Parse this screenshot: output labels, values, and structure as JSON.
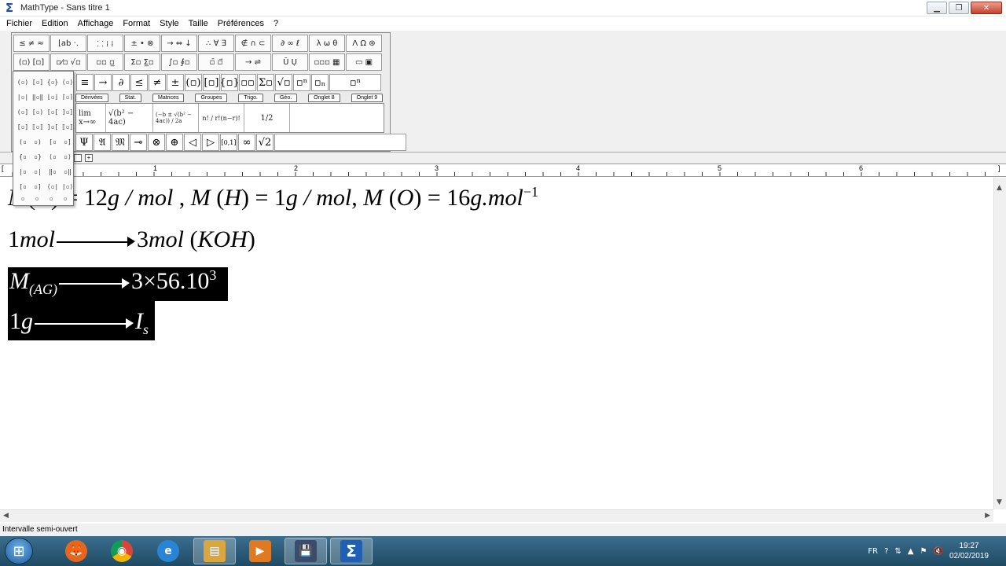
{
  "window": {
    "title": "MathType - Sans titre 1",
    "app_icon": "Σ",
    "minimize": "▁",
    "maximize": "❐",
    "close": "✕"
  },
  "menu": [
    "Fichier",
    "Edition",
    "Affichage",
    "Format",
    "Style",
    "Taille",
    "Préférences",
    "?"
  ],
  "palette": {
    "row1": [
      "≤ ≠ ≈",
      "⌊ab ·.",
      "⸬ ⁞ ⁞",
      "± • ⊗",
      "→ ⇔ ↓",
      "∴ ∀ ∃",
      "∉ ∩ ⊂",
      "∂ ∞ ℓ",
      "λ ω θ",
      "Λ Ω ⊛"
    ],
    "row2": [
      "(▫) [▫]",
      "▫⁄▫ √▫",
      "▫▫ ▫̲",
      "Σ▫ Σ̲▫",
      "∫▫ ∮▫",
      "▫̄ ▫⃗",
      "→ ⇌",
      "Ū Ụ",
      "▫▫▫ ▦",
      "▭ ▣"
    ],
    "small_row1": [
      "≡",
      "→",
      "∂",
      "≤",
      "≠",
      "±",
      "(▫)",
      "[▫]",
      "{▫}",
      "▫▫",
      "Σ▫",
      "√▫",
      "▫ⁿ",
      "▫ₙ",
      "▫ⁿ"
    ],
    "tabs": [
      "Dérivées",
      "Stat.",
      "Matrices",
      "Groupes",
      "Trigo.",
      "Géo.",
      "Onglet 8",
      "Onglet 9"
    ],
    "templates": [
      "lim x→∞",
      "√(b² − 4ac)",
      "(−b ± √(b² − 4ac)) / 2a",
      "n! / r!(n−r)!",
      "1/2"
    ],
    "small_row3": [
      "Ψ",
      "𝔄",
      "𝔐",
      "⊸",
      "⊗",
      "⊕",
      "◁",
      "▷",
      "[0,1]",
      "∞",
      "√2"
    ],
    "dropdown_cells": [
      "(▫)",
      "[▫]",
      "{▫}",
      "⟨▫⟩",
      "|▫|",
      "‖▫‖",
      "⌊▫⌋",
      "⌈▫⌉",
      "(▫]",
      "[▫)",
      "[▫[",
      "]▫]",
      "[▫]",
      "⟦▫⟧",
      "]▫[",
      "⟦▫⟧",
      "(▫",
      "▫)",
      "[▫",
      "▫]",
      "{▫",
      "▫}",
      "⟨▫",
      "▫⟩",
      "|▫",
      "▫|",
      "‖▫",
      "▫‖",
      "[▫",
      "▫]",
      "⟨▫|",
      "|▫⟩"
    ],
    "dropdown_footer": [
      "▫",
      "▫",
      "▫",
      "▫"
    ]
  },
  "ruler": {
    "numbers": [
      "1",
      "2",
      "3",
      "4",
      "5",
      "6"
    ],
    "left_marker": "[",
    "right_marker": "]"
  },
  "equations": {
    "line1": {
      "p1": "M",
      "p2": "(",
      "p3": "C",
      "p4": ")",
      "p5": " = 12",
      "p6": "g / mol",
      "p7": "  , ",
      "p8": "M",
      "p9": " (",
      "p10": "H",
      "p11": ") = 1",
      "p12": "g / mol",
      "p13": ", ",
      "p14": "M",
      "p15": " (",
      "p16": "O",
      "p17": ") = 16",
      "p18": "g.mol",
      "p19": "−1"
    },
    "line2": {
      "p1": "1",
      "p2": "mol",
      "p3": "3",
      "p4": "mol",
      "p5": " (",
      "p6": "KOH",
      "p7": ")"
    },
    "line3": {
      "p1": "M",
      "p2": "(AG)",
      "p3": "3×56.10",
      "p4": "3"
    },
    "line4": {
      "p1": "1",
      "p2": "g",
      "p3": "I",
      "p4": "s"
    }
  },
  "status_text": "Intervalle semi-ouvert",
  "taskbar": {
    "start_icon": "windows-logo",
    "apps": [
      {
        "name": "firefox",
        "glyph": "🦊"
      },
      {
        "name": "chrome",
        "glyph": "◉"
      },
      {
        "name": "internet-explorer",
        "glyph": "e"
      },
      {
        "name": "file-explorer",
        "glyph": "▤"
      },
      {
        "name": "media-player",
        "glyph": "▶"
      },
      {
        "name": "recorder",
        "glyph": "💾"
      },
      {
        "name": "mathtype",
        "glyph": "Σ"
      }
    ],
    "tray_lang": "FR",
    "tray_icons": [
      "?",
      "⇅",
      "▲",
      "⚑",
      "🔇"
    ],
    "time": "19:27",
    "date": "02/02/2019"
  }
}
